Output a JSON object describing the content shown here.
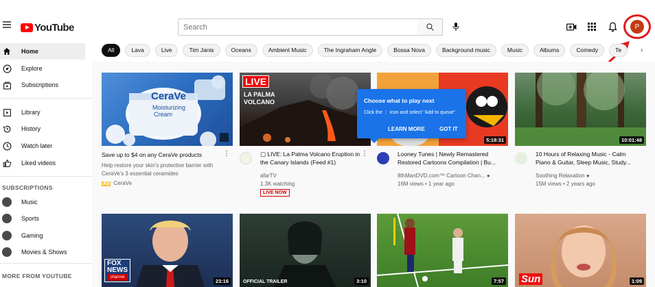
{
  "header": {
    "logo_text": "YouTube",
    "search_placeholder": "Search",
    "avatar_letter": "P"
  },
  "sidebar": {
    "primary": [
      {
        "label": "Home",
        "icon": "home-icon",
        "active": true
      },
      {
        "label": "Explore",
        "icon": "compass-icon"
      },
      {
        "label": "Subscriptions",
        "icon": "subscriptions-icon"
      }
    ],
    "library": [
      {
        "label": "Library",
        "icon": "library-icon"
      },
      {
        "label": "History",
        "icon": "history-icon"
      },
      {
        "label": "Watch later",
        "icon": "clock-icon"
      },
      {
        "label": "Liked videos",
        "icon": "thumbs-up-icon"
      }
    ],
    "subscriptions_title": "SUBSCRIPTIONS",
    "subscriptions": [
      {
        "label": "Music"
      },
      {
        "label": "Sports"
      },
      {
        "label": "Gaming"
      },
      {
        "label": "Movies & Shows"
      }
    ],
    "more_title": "MORE FROM YOUTUBE"
  },
  "chips": [
    "All",
    "Lava",
    "Live",
    "Tim Janis",
    "Oceans",
    "Ambient Music",
    "The Ingraham Angle",
    "Bossa Nova",
    "Background music",
    "Music",
    "Albums",
    "Comedy",
    "Te"
  ],
  "tooltip": {
    "title": "Choose what to play next",
    "body": "Click the ⋮ icon and select \"Add to queue\"",
    "learn_more": "LEARN MORE",
    "got_it": "GOT IT"
  },
  "videos": [
    {
      "title_1": "Save up to $4 on any CeraVe products",
      "title_2": "",
      "desc_1": "Help restore your skin's protective barrier with",
      "desc_2": "CeraVe's 3 essential ceramides",
      "ad_label": "Ad",
      "channel": "CeraVe",
      "thumb_text_1": "CeraVe",
      "thumb_text_2": "Moisturizing",
      "thumb_text_3": "Cream"
    },
    {
      "title_1": "▢ LIVE: La Palma Volcano Eruption in",
      "title_2": "the Canary Islands (Feed #1)",
      "channel": "afarTV",
      "meta": "1.3K watching",
      "live_badge": "LIVE NOW",
      "thumb_live": "LIVE",
      "thumb_text_1": "LA PALMA",
      "thumb_text_2": "VOLCANO"
    },
    {
      "title_1": "Looney Tunes | Newly Remastered",
      "title_2": "Restored Cartoons Compilation | Bu...",
      "channel": "8thManDVD.com™ Cartoon Chan...",
      "meta": "16M views • 1 year ago",
      "duration": "5:18:31"
    },
    {
      "title_1": "10 Hours of Relaxing Music - Calm",
      "title_2": "Piano & Guitar, Sleep Music, Study...",
      "channel": "Soothing Relaxation",
      "meta": "15M views • 2 years ago",
      "duration": "10:01:48"
    },
    {
      "duration": "23:16",
      "thumb_text_1": "FOX",
      "thumb_text_2": "NEWS",
      "thumb_text_3": "channel"
    },
    {
      "duration": "3:10",
      "thumb_text_1": "OFFICIAL TRAILER"
    },
    {
      "duration": "7:57"
    },
    {
      "duration": "1:09",
      "thumb_text_1": "Sun"
    }
  ]
}
